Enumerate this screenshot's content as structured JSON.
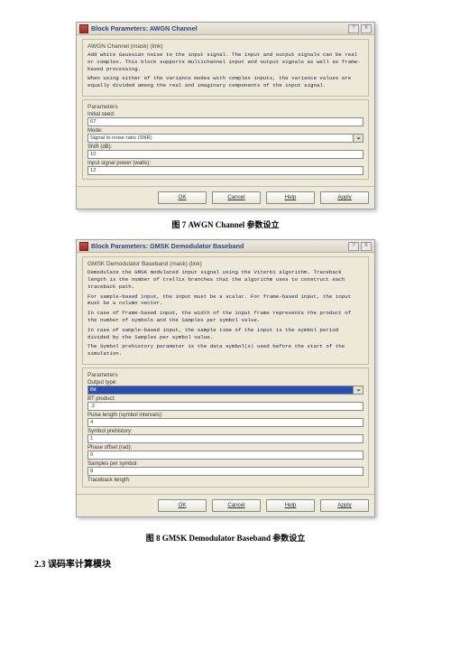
{
  "captions": {
    "fig7": "图 7 AWGN Channel 参数设立",
    "fig8": "图 8 GMSK Demodulator Baseband 参数设立"
  },
  "section_2_3": "2.3  误码率计算模块",
  "dialog1": {
    "title": "Block Parameters: AWGN Channel",
    "group_title": "AWGN Channel (mask) (link)",
    "desc1": "Add white Gaussian noise to the input signal. The input and output signals can be real or complex. This block supports multichannel input and output signals as well as frame-based processing.",
    "desc2": "When using either of the variance modes with complex inputs, the variance values are equally divided among the real and imaginary components of the input signal.",
    "params_label": "Parameters",
    "initial_seed_label": "Initial seed:",
    "initial_seed_value": "67",
    "mode_label": "Mode:",
    "mode_value": "Signal to noise ratio  (SNR)",
    "snr_label": "SNR (dB):",
    "snr_value": "10",
    "power_label": "Input signal power (watts):",
    "power_value": "12"
  },
  "dialog2": {
    "title": "Block Parameters: GMSK Demodulator Baseband",
    "group_title": "GMSK Demodulator Baseband (mask) (link)",
    "desc1": "Demodulate the GMSK modulated input signal using the Viterbi algorithm. Traceback length is the number of trellis branches that the algorithm uses to construct each traceback path.",
    "desc2": "For sample-based input, the input must be a scalar. For frame-based input, the input must be a column vector.",
    "desc3": "In case of frame-based input, the width of the input frame represents the product of the number of symbols and the Samples per symbol value.",
    "desc4": "In case of sample-based input, the sample time of the input is the symbol period divided by the Samples per symbol value.",
    "desc5": "The Symbol prehistory parameter is the data symbol(s) used before the start of the simulation.",
    "params_label": "Parameters",
    "output_type_label": "Output type:",
    "output_type_value": "Bit",
    "bt_label": "BT product:",
    "bt_value": ".3",
    "pulse_label": "Pulse length (symbol intervals):",
    "pulse_value": "4",
    "prehist_label": "Symbol prehistory:",
    "prehist_value": "1",
    "phase_label": "Phase offset (rad):",
    "phase_value": "0",
    "sps_label": "Samples per symbol:",
    "sps_value": "8",
    "traceback_label": "Traceback length:"
  },
  "buttons": {
    "ok": "OK",
    "cancel": "Cancel",
    "help": "Help",
    "apply": "Apply"
  },
  "winbtns": {
    "help": "?",
    "close": "X"
  }
}
